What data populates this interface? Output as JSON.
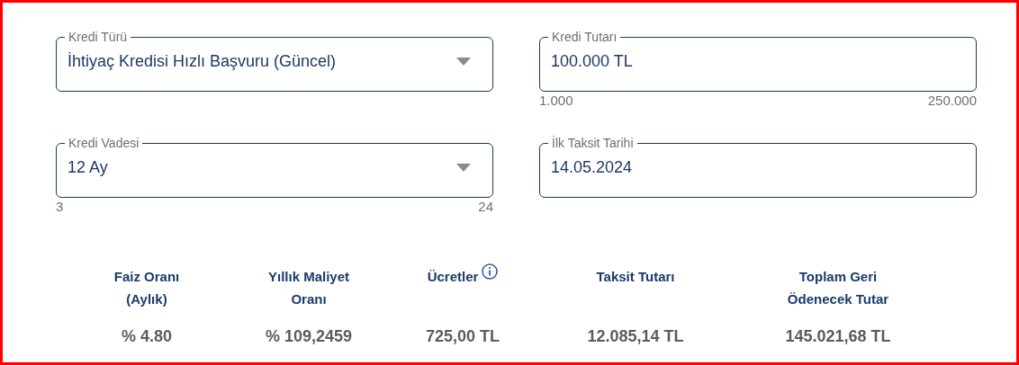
{
  "fields": [
    {
      "label": "Kredi Türü",
      "value": "İhtiyaç Kredisi Hızlı Başvuru (Güncel)",
      "kind": "select"
    },
    {
      "label": "Kredi Tutarı",
      "value": "100.000 TL",
      "kind": "text",
      "min": "1.000",
      "max": "250.000"
    },
    {
      "label": "Kredi Vadesi",
      "value": "12 Ay",
      "kind": "select",
      "min": "3",
      "max": "24"
    },
    {
      "label": "İlk Taksit Tarihi",
      "value": "14.05.2024",
      "kind": "text"
    }
  ],
  "summary": [
    {
      "lines": [
        "Faiz Oranı",
        "(Aylık)"
      ],
      "value": "% 4.80"
    },
    {
      "lines": [
        "Yıllık Maliyet",
        "Oranı"
      ],
      "value": "% 109,2459"
    },
    {
      "lines": [
        "Ücretler"
      ],
      "value": "725,00 TL",
      "info": true
    },
    {
      "lines": [
        "Taksit Tutarı"
      ],
      "value": "12.085,14 TL"
    },
    {
      "lines": [
        "Toplam Geri",
        "Ödenecek Tutar"
      ],
      "value": "145.021,68 TL"
    }
  ]
}
